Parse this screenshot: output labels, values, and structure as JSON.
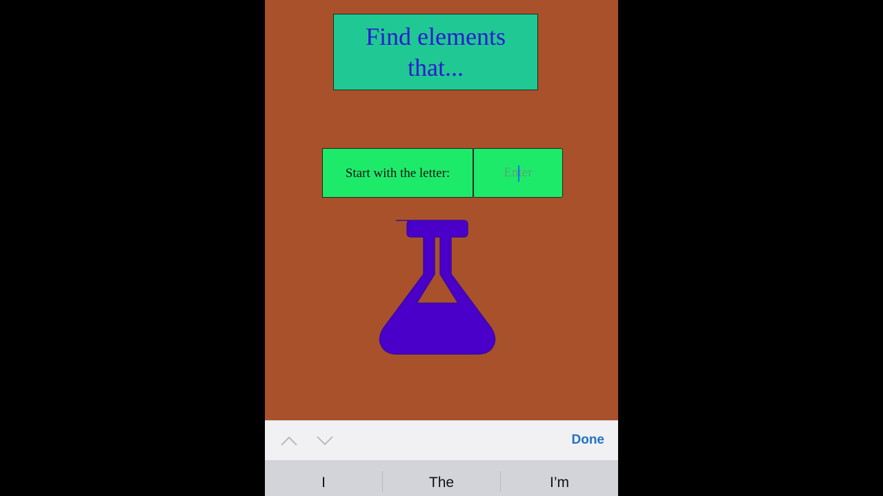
{
  "title": {
    "text": "Find elements that..."
  },
  "prompt": {
    "label": "Start with the letter:"
  },
  "letter_input": {
    "value": "",
    "placeholder": "Enter"
  },
  "illustration": {
    "icon": "flask-icon",
    "color": "#4a00c8"
  },
  "keyboard_toolbar": {
    "prev_icon": "chevron-up-icon",
    "next_icon": "chevron-down-icon",
    "done_label": "Done"
  },
  "suggestions": [
    {
      "text": "I"
    },
    {
      "text": "The"
    },
    {
      "text": "I’m"
    }
  ],
  "colors": {
    "background": "#a9512b",
    "title_box": "#20c993",
    "title_text": "#2c1ad1",
    "prompt_box": "#1eea6a",
    "done": "#1f73c2"
  }
}
